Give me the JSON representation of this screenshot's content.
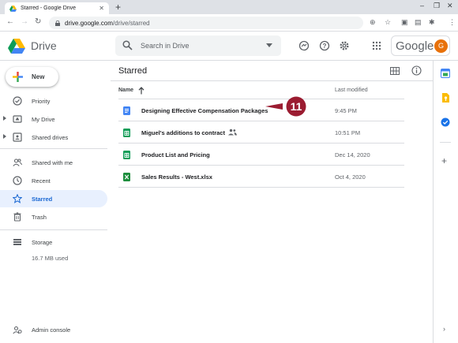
{
  "browser": {
    "tab_title": "Starred - Google Drive",
    "url_host": "drive.google.com",
    "url_path": "/drive/starred"
  },
  "header": {
    "brand": "Drive",
    "search_placeholder": "Search in Drive",
    "google_word": "Google",
    "avatar_initial": "G"
  },
  "sidebar": {
    "new_label": "New",
    "items": [
      {
        "label": "Priority",
        "icon": "priority-icon"
      },
      {
        "label": "My Drive",
        "icon": "my-drive-icon"
      },
      {
        "label": "Shared drives",
        "icon": "shared-drives-icon"
      },
      {
        "label": "Shared with me",
        "icon": "shared-with-me-icon"
      },
      {
        "label": "Recent",
        "icon": "clock-icon"
      },
      {
        "label": "Starred",
        "icon": "star-icon"
      },
      {
        "label": "Trash",
        "icon": "trash-icon"
      }
    ],
    "storage_label": "Storage",
    "storage_used": "16.7 MB used",
    "admin_label": "Admin console"
  },
  "main": {
    "title": "Starred",
    "col_name": "Name",
    "col_modified": "Last modified",
    "files": [
      {
        "name": "Designing Effective Compensation Packages",
        "modified": "9:45 PM",
        "type": "doc",
        "shared": false
      },
      {
        "name": "Miguel's additions to contract",
        "modified": "10:51 PM",
        "type": "sheet",
        "shared": true
      },
      {
        "name": "Product List and Pricing",
        "modified": "Dec 14, 2020",
        "type": "sheet",
        "shared": false
      },
      {
        "name": "Sales Results - West.xlsx",
        "modified": "Oct 4, 2020",
        "type": "excel",
        "shared": false
      }
    ],
    "callout_number": "11"
  },
  "colors": {
    "accent": "#1967d2",
    "active_bg": "#e8f0fe",
    "callout": "#9b1c31",
    "doc": "#4285f4",
    "sheet": "#0f9d58",
    "excel": "#1e8e3e"
  }
}
